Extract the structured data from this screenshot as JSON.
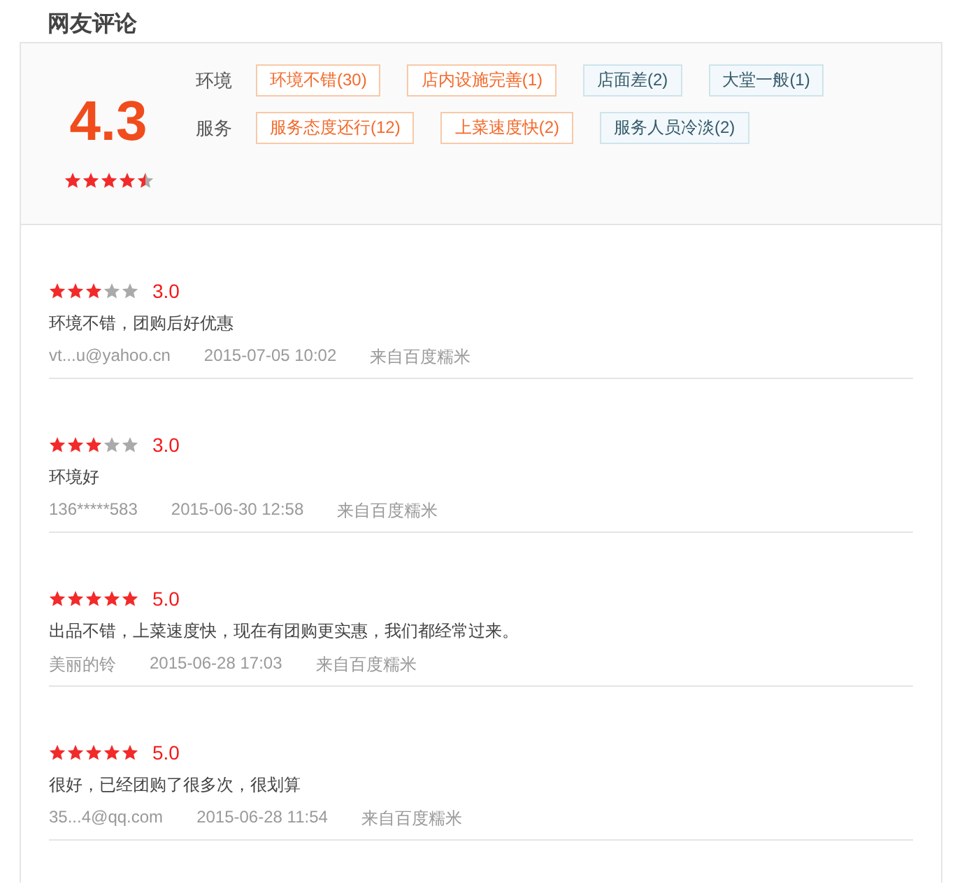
{
  "title": "网友评论",
  "summary": {
    "score": "4.3",
    "stars": 4.5,
    "groups": [
      {
        "label": "环境",
        "tags": [
          {
            "text": "环境不错(30)",
            "kind": "positive"
          },
          {
            "text": "店内设施完善(1)",
            "kind": "positive"
          },
          {
            "text": "店面差(2)",
            "kind": "negative"
          },
          {
            "text": "大堂一般(1)",
            "kind": "negative"
          }
        ]
      },
      {
        "label": "服务",
        "tags": [
          {
            "text": "服务态度还行(12)",
            "kind": "positive"
          },
          {
            "text": "上菜速度快(2)",
            "kind": "positive"
          },
          {
            "text": "服务人员冷淡(2)",
            "kind": "negative"
          }
        ]
      }
    ]
  },
  "reviews": [
    {
      "stars": 3,
      "score": "3.0",
      "text": "环境不错，团购后好优惠",
      "user": "vt...u@yahoo.cn",
      "time": "2015-07-05 10:02",
      "source": "来自百度糯米"
    },
    {
      "stars": 3,
      "score": "3.0",
      "text": "环境好",
      "user": "136*****583",
      "time": "2015-06-30 12:58",
      "source": "来自百度糯米"
    },
    {
      "stars": 5,
      "score": "5.0",
      "text": "出品不错，上菜速度快，现在有团购更实惠，我们都经常过来。",
      "user": "美丽的铃",
      "time": "2015-06-28 17:03",
      "source": "来自百度糯米"
    },
    {
      "stars": 5,
      "score": "5.0",
      "text": "很好，已经团购了很多次，很划算",
      "user": "35...4@qq.com",
      "time": "2015-06-28 11:54",
      "source": "来自百度糯米"
    }
  ]
}
